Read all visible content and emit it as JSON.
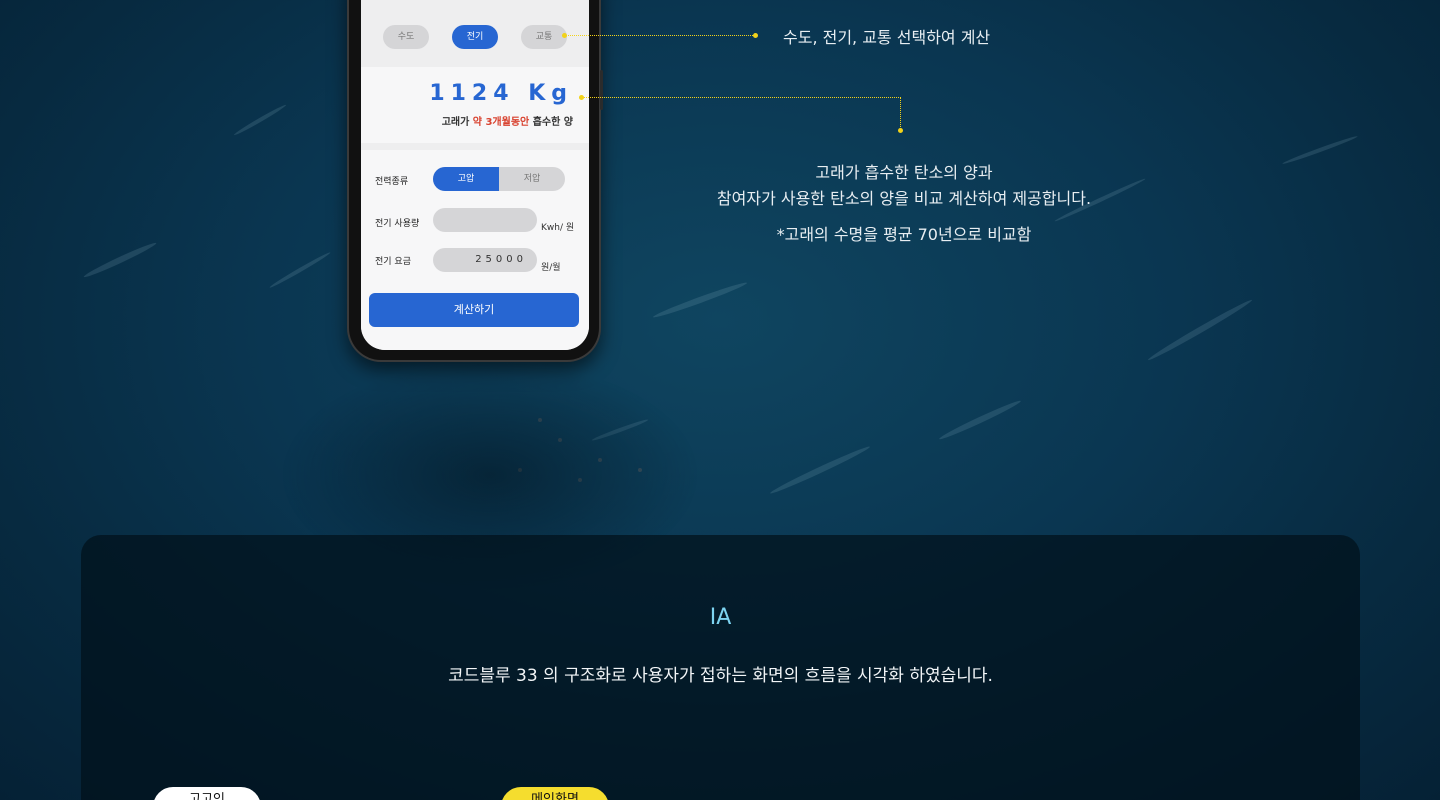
{
  "colors": {
    "background": "#0a3651",
    "accent_blue": "#2766d2",
    "highlight_red": "#d8412e",
    "callout_yellow": "#f2d21a",
    "ia_title": "#7dd3f0"
  },
  "phone": {
    "tabs": [
      {
        "label": "수도",
        "active": false
      },
      {
        "label": "전기",
        "active": true
      },
      {
        "label": "교통",
        "active": false
      }
    ],
    "result": {
      "value": "1124 Kg",
      "caption_prefix": "고래가 ",
      "caption_highlight": "약 3개월동안",
      "caption_suffix": " 흡수한 양"
    },
    "form": {
      "power_type_label": "전력종류",
      "power_type_options": [
        "고압",
        "저압"
      ],
      "power_type_selected": "고압",
      "usage_label": "전기 사용량",
      "usage_value": "",
      "usage_unit": "Kwh/ 원",
      "fee_label": "전기 요금",
      "fee_value": "25000",
      "fee_unit": "원/월"
    },
    "calc_button": "계산하기"
  },
  "callouts": {
    "tabs_note": "수도, 전기, 교통 선택하여 계산",
    "result_desc_line1": "고래가 흡수한 탄소의 양과",
    "result_desc_line2": "참여자가 사용한 탄소의 양을 비교 계산하여 제공합니다.",
    "result_footnote": "*고래의 수명을 평균 70년으로 비교함"
  },
  "ia": {
    "title": "IA",
    "subtitle": "코드블루 33 의 구조화로 사용자가  접하는 화면의 흐름을 시각화 하였습니다.",
    "pills": [
      "고고인",
      "메인화면"
    ]
  }
}
